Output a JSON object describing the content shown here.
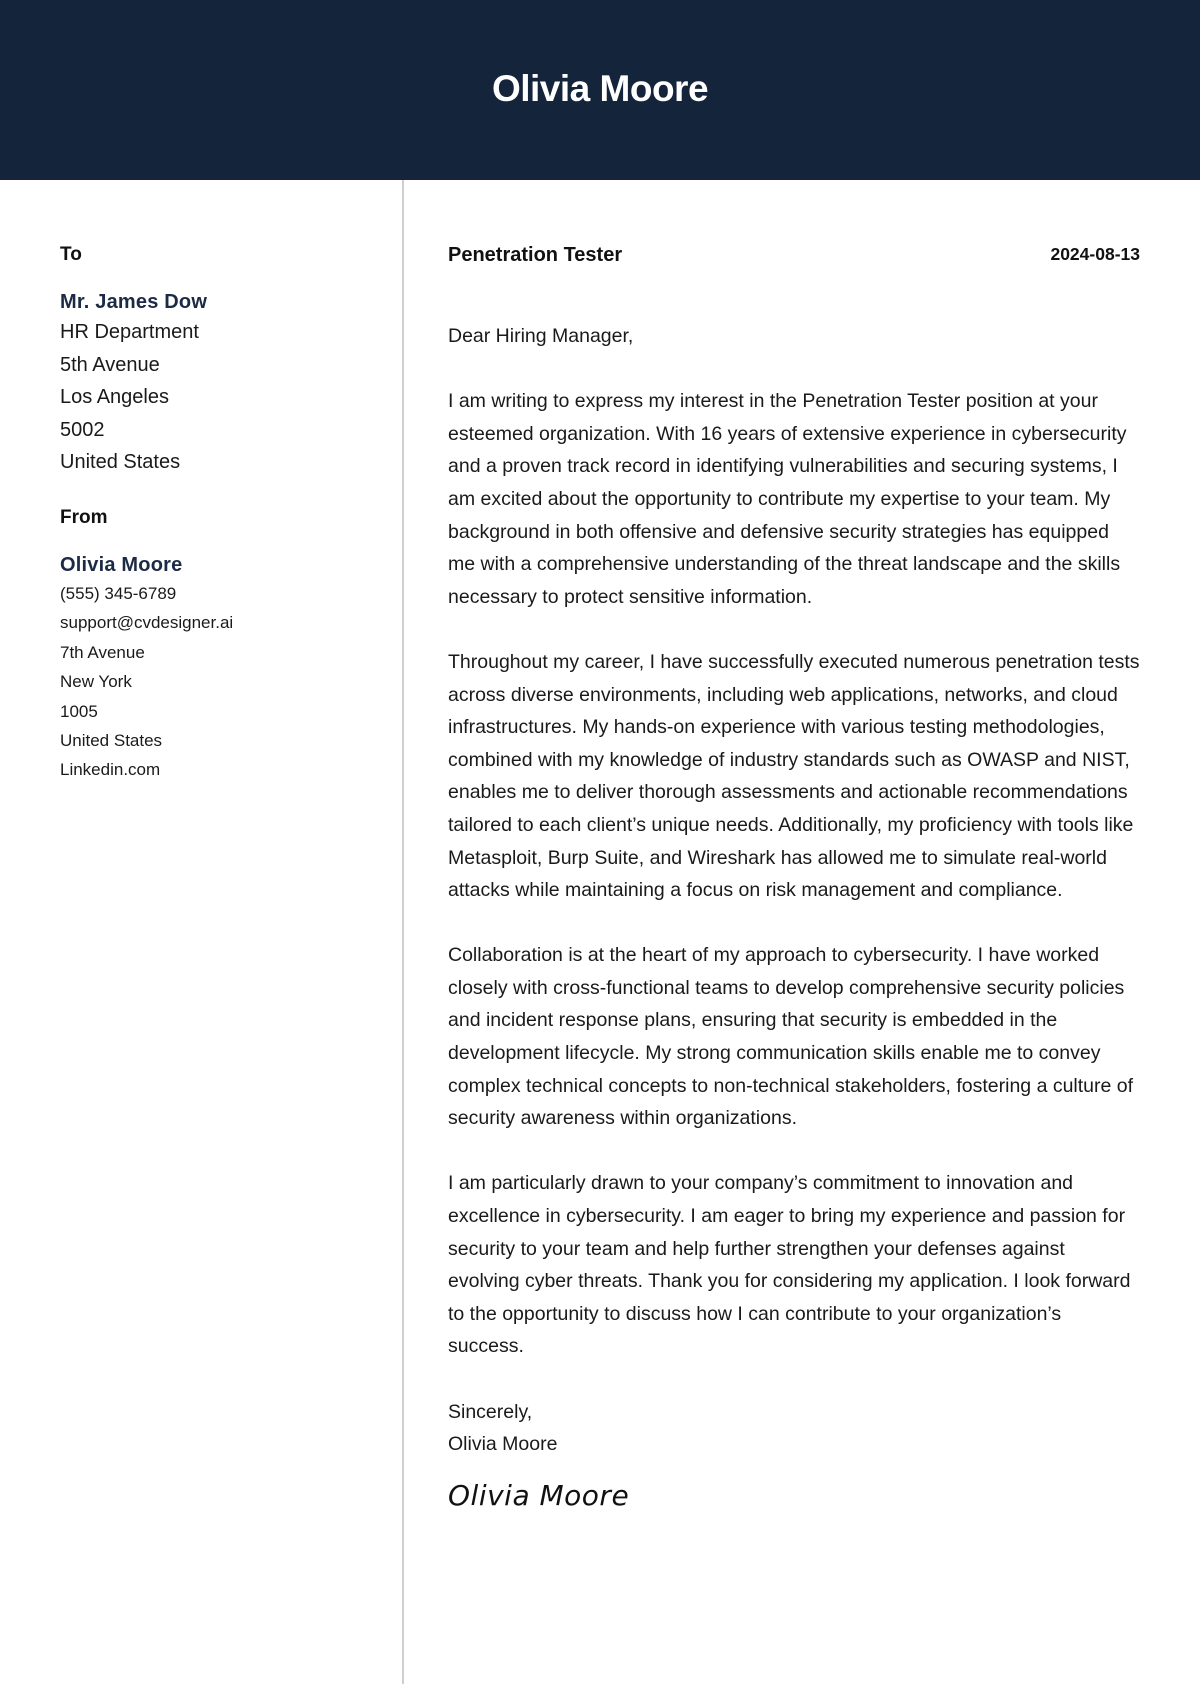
{
  "header": {
    "name": "Olivia Moore",
    "background_color": "#14243a"
  },
  "sidebar": {
    "to": {
      "heading": "To",
      "name": "Mr. James Dow",
      "lines": [
        "HR Department",
        "5th Avenue",
        "Los Angeles",
        "5002",
        "United States"
      ]
    },
    "from": {
      "heading": "From",
      "name": "Olivia Moore",
      "phone": "(555) 345-6789",
      "email": "support@cvdesigner.ai",
      "street": "7th Avenue",
      "city": "New York",
      "postal_code": "1005",
      "country": "United States",
      "website": "Linkedin.com"
    }
  },
  "letter": {
    "job_title": "Penetration Tester",
    "date": "2024-08-13",
    "salutation": "Dear Hiring Manager,",
    "paragraphs": [
      "I am writing to express my interest in the Penetration Tester position at your esteemed organization. With 16 years of extensive experience in cybersecurity and a proven track record in identifying vulnerabilities and securing systems, I am excited about the opportunity to contribute my expertise to your team. My background in both offensive and defensive security strategies has equipped me with a comprehensive understanding of the threat landscape and the skills necessary to protect sensitive information.",
      "Throughout my career, I have successfully executed numerous penetration tests across diverse environments, including web applications, networks, and cloud infrastructures. My hands-on experience with various testing methodologies, combined with my knowledge of industry standards such as OWASP and NIST, enables me to deliver thorough assessments and actionable recommendations tailored to each client’s unique needs. Additionally, my proficiency with tools like Metasploit, Burp Suite, and Wireshark has allowed me to simulate real-world attacks while maintaining a focus on risk management and compliance.",
      "Collaboration is at the heart of my approach to cybersecurity. I have worked closely with cross-functional teams to develop comprehensive security policies and incident response plans, ensuring that security is embedded in the development lifecycle. My strong communication skills enable me to convey complex technical concepts to non-technical stakeholders, fostering a culture of security awareness within organizations.",
      "I am particularly drawn to your company’s commitment to innovation and excellence in cybersecurity. I am eager to bring my experience and passion for security to your team and help further strengthen your defenses against evolving cyber threats. Thank you for considering my application. I look forward to the opportunity to discuss how I can contribute to your organization’s success."
    ],
    "closing": "Sincerely,",
    "closing_name": "Olivia Moore",
    "signature": "Olivia Moore"
  }
}
